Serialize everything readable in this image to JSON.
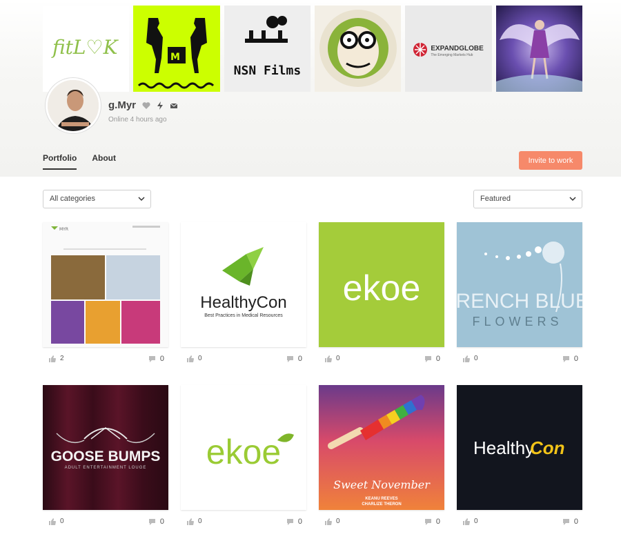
{
  "profile": {
    "username": "g.Myr",
    "status": "Online 4 hours ago"
  },
  "cover_texts": {
    "fitlook": "fitL♡K",
    "nsn": "NSN Films",
    "expand_title": "EXPANDGLOBE",
    "expand_sub": "The Emerging Markets Hub"
  },
  "tabs": [
    {
      "label": "Portfolio",
      "active": true
    },
    {
      "label": "About",
      "active": false
    }
  ],
  "invite_button": "Invite to work",
  "filters": {
    "category": "All categories",
    "sort": "Featured"
  },
  "cards": [
    {
      "likes": "2",
      "comments": "0",
      "logo": "MYR"
    },
    {
      "likes": "0",
      "comments": "0",
      "logo": "HealthyCon",
      "sub": "Best Practices in Medical Resources"
    },
    {
      "likes": "0",
      "comments": "0",
      "logo": "ekoe"
    },
    {
      "likes": "0",
      "comments": "0",
      "logo": "FRENCH BLUE",
      "sub": "FLOWERS"
    },
    {
      "likes": "0",
      "comments": "0",
      "logo": "GOOSE BUMPS",
      "sub": "ADULT ENTERTAINMENT LOUGE"
    },
    {
      "likes": "0",
      "comments": "0",
      "logo": "ekoe"
    },
    {
      "likes": "0",
      "comments": "0",
      "logo": "Sweet November",
      "sub": "KEANU REEVES",
      "sub2": "CHARLIZE THERON"
    },
    {
      "likes": "0",
      "comments": "0",
      "logo": "Healthy",
      "logo2": "Con"
    }
  ],
  "colors": {
    "accent": "#f6896a",
    "lime": "#ccff00",
    "green": "#a4cc3a",
    "blue_card": "#9fc3d6",
    "dark_card": "#12151e"
  }
}
